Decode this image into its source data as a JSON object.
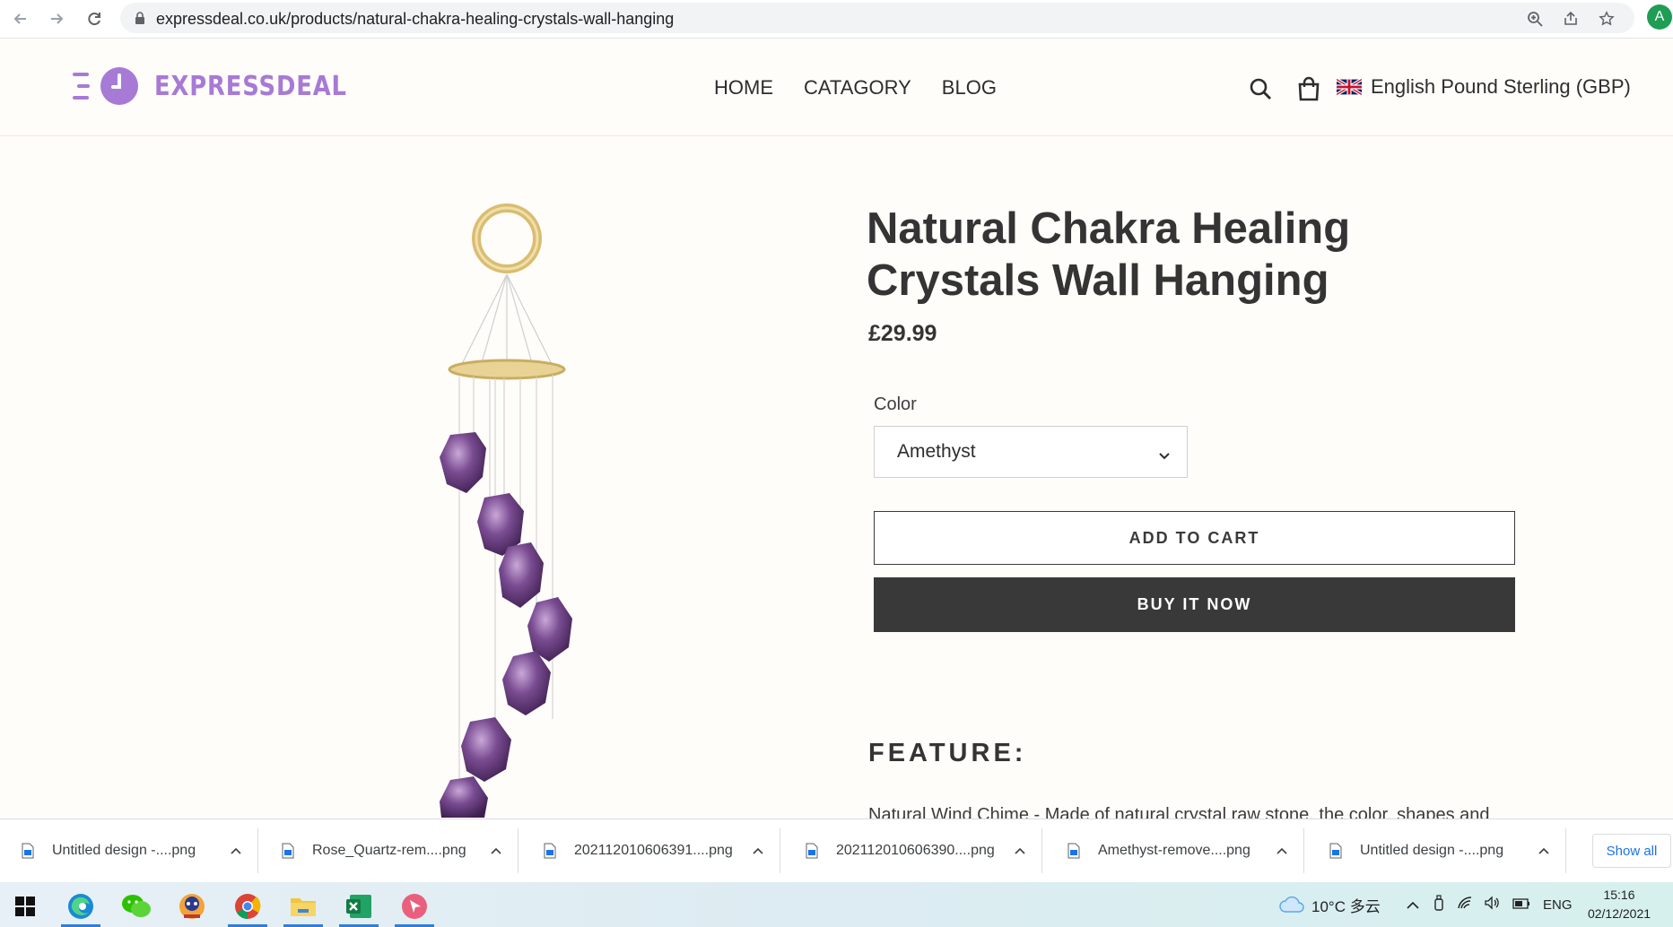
{
  "browser": {
    "url": "expressdeal.co.uk/products/natural-chakra-healing-crystals-wall-hanging",
    "profile_initial": "A"
  },
  "site": {
    "logo_text": "EXPRESSDEAL",
    "nav": [
      "HOME",
      "CATAGORY",
      "BLOG"
    ],
    "currency": "English Pound Sterling (GBP)"
  },
  "product": {
    "title": "Natural Chakra Healing Crystals Wall Hanging",
    "price": "£29.99",
    "color_label": "Color",
    "color_value": "Amethyst",
    "add_to_cart": "ADD TO CART",
    "buy_now": "BUY IT NOW",
    "feature_heading": "FEATURE:",
    "description": "Natural Wind Chime - Made of natural crystal raw stone, the color, shapes and"
  },
  "downloads": {
    "items": [
      "Untitled design -....png",
      "Rose_Quartz-rem....png",
      "202112010606391....png",
      "202112010606390....png",
      "Amethyst-remove....png",
      "Untitled design -....png"
    ],
    "show_all": "Show all"
  },
  "taskbar": {
    "weather": "10°C 多云",
    "language": "ENG",
    "time": "15:16",
    "date": "02/12/2021"
  },
  "colors": {
    "brand": "#a77ad6",
    "buy_button": "#393939",
    "page_bg": "#fffdf9"
  }
}
